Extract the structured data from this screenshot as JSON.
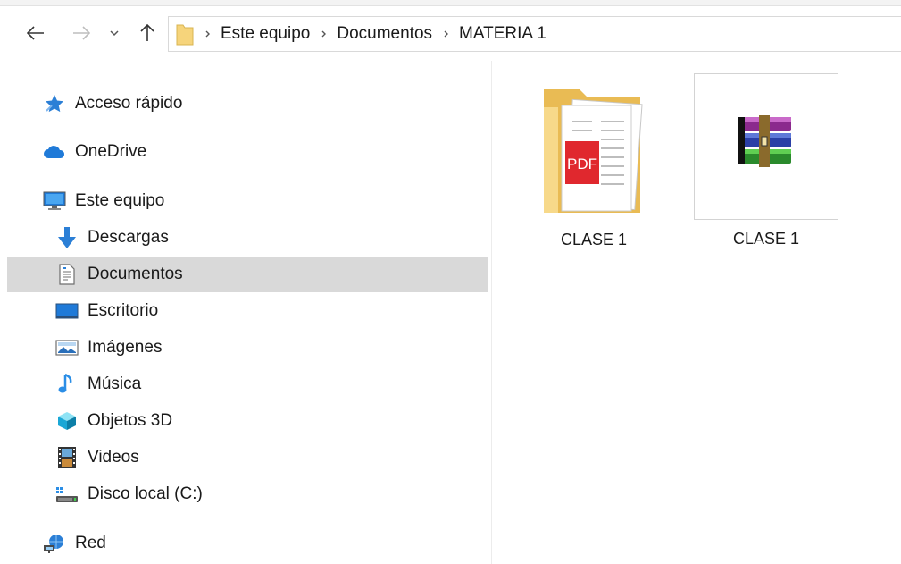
{
  "address_bar": {
    "back_icon": "arrow-left-icon",
    "forward_icon": "arrow-right-icon",
    "recent_icon": "chevron-down-icon",
    "up_icon": "arrow-up-icon",
    "breadcrumb": [
      "Este equipo",
      "Documentos",
      "MATERIA 1"
    ]
  },
  "sidebar": {
    "items": [
      {
        "label": "Acceso rápido",
        "icon": "star-icon"
      },
      {
        "label": "OneDrive",
        "icon": "cloud-icon"
      },
      {
        "label": "Este equipo",
        "icon": "monitor-icon"
      },
      {
        "label": "Descargas",
        "icon": "download-arrow-icon"
      },
      {
        "label": "Documentos",
        "icon": "document-icon",
        "selected": true
      },
      {
        "label": "Escritorio",
        "icon": "desktop-icon"
      },
      {
        "label": "Imágenes",
        "icon": "picture-icon"
      },
      {
        "label": "Música",
        "icon": "music-note-icon"
      },
      {
        "label": "Objetos 3D",
        "icon": "cube-icon"
      },
      {
        "label": "Videos",
        "icon": "film-icon"
      },
      {
        "label": "Disco local (C:)",
        "icon": "drive-icon"
      },
      {
        "label": "Red",
        "icon": "network-icon"
      }
    ]
  },
  "content": {
    "items": [
      {
        "label": "CLASE 1",
        "type": "folder",
        "icon": "folder-pdf-icon",
        "badge": "PDF"
      },
      {
        "label": "CLASE 1",
        "type": "archive",
        "icon": "winrar-archive-icon"
      }
    ]
  },
  "colors": {
    "selection": "#d9d9d9",
    "folder": "#f6d47b",
    "pdf_red": "#e0282e",
    "accent_blue": "#1f7ad8"
  }
}
